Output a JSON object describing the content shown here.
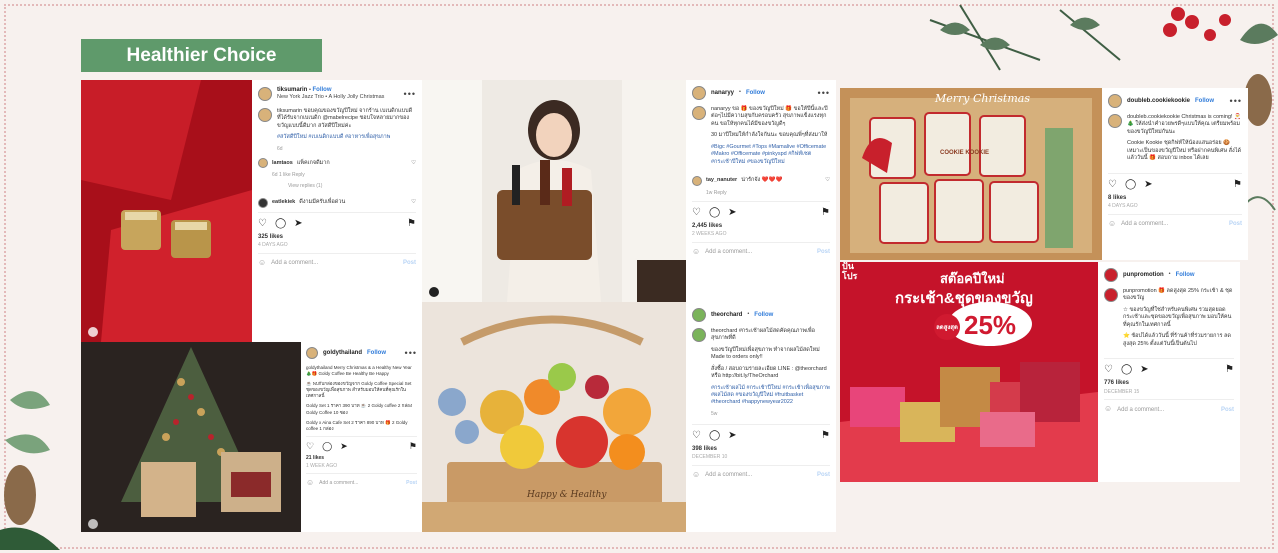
{
  "section_title": "Healthier Choice",
  "posts": {
    "p1": {
      "username": "tiksumarin",
      "follow": "Follow",
      "subtitle": "New York Jazz Trio • A Holly Jolly Christmas",
      "caption": "tiksumarin ขอบคุณของขวัญปีใหม่ จากร้าน เบเนดิกแบบดี ที่ได้รับจากเบเนดิก @mabelrecipe ชอบใจหลายมากของขวัญแบบนี้ดีมาก สวัสดีปีใหม่ค่ะ",
      "hashtags": "#สวัสดีปีใหม่ #เบเนดิกแบบดี #อาหารเพื่อสุขภาพ",
      "age": "6d",
      "comment1_user": "lamtaos",
      "comment1_text": "แพ็คเกจดีมาก",
      "comment1_meta": "6d   1 like   Reply",
      "view_replies": "View replies (1)",
      "comment2_user": "eatlekiek",
      "comment2_text": "ดีงามมีครับเพื่อด่วน",
      "likes": "325 likes",
      "date": "4 DAYS AGO",
      "add_comment": "Add a comment...",
      "post_btn": "Post"
    },
    "p2": {
      "username": "nanaryy",
      "follow": "Follow",
      "caption": "nanaryy ขอ 🎁 ของขวัญปีใหม่ 🎁 ขอให้ปีนี้และปีต่อๆไปมีความสุขกับครอบครัว สุขภาพแข็งแรงทุกคน ขอให้ทุกคนได้มีของขวัญดีๆ",
      "line2": "30 มาปีใหม่ให้กำลังใจกันนะ ขอบคุณพี่ๆที่ส่งมาให้",
      "hashtags": "#Bigc #Gourmet #Tops #Mamalive #Officemate #Makro #Officemate #pinkyspd #กิฟท์เซต #กระเช้าปีใหม่ #ของขวัญปีใหม่",
      "comment_user": "tay_nanuter",
      "comment_text": "น่ารักจัง ❤️❤️❤️",
      "comment_meta": "1w   Reply",
      "likes": "2,445 likes",
      "date": "2 WEEKS AGO",
      "add_comment": "Add a comment...",
      "post_btn": "Post"
    },
    "p3": {
      "username": "doubleb.cookiekookie",
      "follow": "Follow",
      "caption": "doubleb.cookiekookie Christmas is coming! 🎅🎄 ให้ส่งนำคำอวยพรดีๆแบบให้คุณ เตรียมพร้อมของขวัญปีใหม่กันนะ",
      "line2": "Cookie Kookie ชุดกิฟท์ให้น้องแสนอร่อย 🍪 เหมาะเป็นของขวัญปีใหม่ หรือฝากคนพิเศษ สั่งได้แล้ววันนี้ 🎁 สอบถาม inbox ได้เลย",
      "likes": "8 likes",
      "date": "4 DAYS AGO",
      "add_comment": "Add a comment...",
      "post_btn": "Post"
    },
    "p4": {
      "username": "goldythailand",
      "follow": "Follow",
      "caption": "goldythailand Merry Christmas & a Healthy New Year 🎄🎁 Goldy Coffee Be Healthy Be Happy",
      "line2": "☕ พบกับกล่องของขวัญจาก Goldy Coffee Special Set ชุดของขวัญเพื่อสุขภาพ สำหรับมอบให้คนที่คุณรักในเทศกาลนี้",
      "line3": "Goldy Set 1 ราคา 390 บาท ☕ 2 Goldy coffee 2 กล่อง Goldy Coffee 10 ซอง",
      "line4": "Goldy x Aina Cafe Set 2 ราคา 890 บาท 🎁 2 Goldy coffee 1 กล่อง",
      "likes": "21 likes",
      "date": "1 WEEK AGO",
      "add_comment": "Add a comment...",
      "post_btn": "Post"
    },
    "p5": {
      "username": "theorchard",
      "follow": "Follow",
      "caption": "theorchard #กระเช้าผลไม้สดคัดคุณภาพเพื่อสุขภาพที่ดี",
      "line2": "ของขวัญปีใหม่เพื่อสุขภาพ ทำจากผลไม้สดใหม่ Made to orders only!!",
      "line3": "สั่งซื้อ / สอบถามรายละเอียด LINE : @theorchard หรือ http://bit.ly/TheOrchard",
      "hashtags": "#กระเช้าผลไม้ #กระเช้าปีใหม่ #กระเช้าเพื่อสุขภาพ #ผลไม้สด #ของขวัญปีใหม่ #fruitbasket #theorchard #happynewyear2022",
      "age": "5w",
      "likes": "398 likes",
      "date": "DECEMBER 10",
      "add_comment": "Add a comment...",
      "post_btn": "Post"
    },
    "p6": {
      "username": "punpromotion",
      "follow": "Follow",
      "caption": "punpromotion 🎁 ลดสูงสุด 25% กระเช้า & ชุดของขวัญ",
      "line2": "☆ ของขวัญที่ใช่สำหรับคนพิเศษ รวมสุดยอดกระเช้าและชุดของขวัญเพื่อสุขภาพ มอบให้คนที่คุณรักในเทศกาลนี้",
      "line3": "⭐ ช้อปได้แล้ววันนี้ ที่ร้านค้าที่ร่วมรายการ ลดสูงสุด 25% ตั้งแต่วันนี้เป็นต้นไป",
      "likes": "776 likes",
      "date": "DECEMBER 15",
      "add_comment": "Add a comment...",
      "post_btn": "Post"
    }
  },
  "photos": {
    "cookie_title": "Merry Christmas",
    "cookie_label": "COOKIE KOOKIE",
    "promo_title": "สต๊อคปีใหม่",
    "promo_subtitle": "กระเช้า&ชุดของขวัญ",
    "promo_badge_small": "ลดสูงสุด",
    "promo_badge": "25%",
    "promo_brand": "ปัน โปร",
    "basket_label": "Happy & Healthy"
  }
}
